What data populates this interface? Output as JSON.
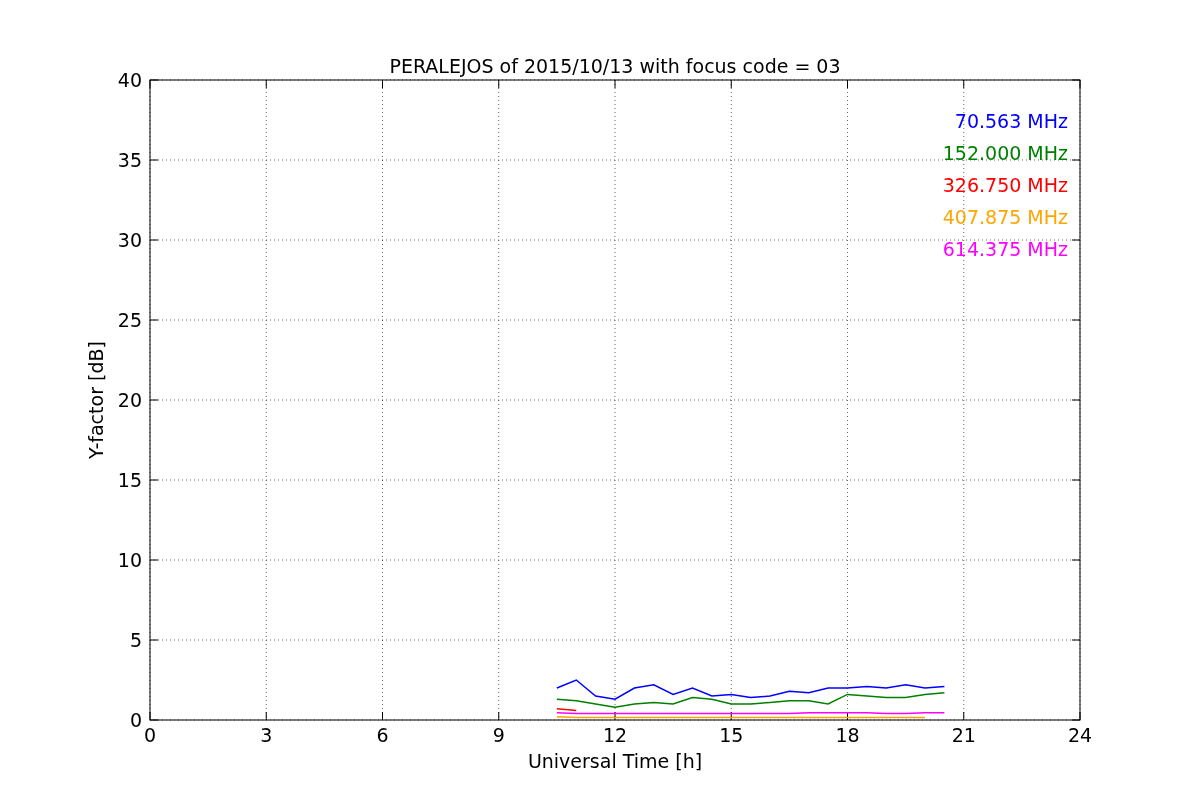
{
  "chart_data": {
    "type": "line",
    "title": "PERALEJOS of 2015/10/13 with focus code = 03",
    "xlabel": "Universal Time [h]",
    "ylabel": "Y-factor [dB]",
    "x": [
      10.5,
      11,
      11.5,
      12,
      12.5,
      13,
      13.5,
      14,
      14.5,
      15,
      15.5,
      16,
      16.5,
      17,
      17.5,
      18,
      18.5,
      19,
      19.5,
      20,
      20.5
    ],
    "series": [
      {
        "name": "70.563 MHz",
        "color": "#0000ff",
        "values": [
          2.0,
          2.5,
          1.5,
          1.3,
          2.0,
          2.2,
          1.6,
          2.0,
          1.5,
          1.6,
          1.4,
          1.5,
          1.8,
          1.7,
          2.0,
          2.0,
          2.1,
          2.0,
          2.2,
          2.0,
          2.1
        ]
      },
      {
        "name": "152.000 MHz",
        "color": "#008000",
        "values": [
          1.3,
          1.2,
          1.0,
          0.8,
          1.0,
          1.1,
          1.0,
          1.4,
          1.3,
          1.0,
          1.0,
          1.1,
          1.2,
          1.2,
          1.0,
          1.6,
          1.5,
          1.4,
          1.4,
          1.6,
          1.7
        ]
      },
      {
        "name": "326.750 MHz",
        "color": "#ff0000",
        "values": [
          0.7,
          0.6,
          null,
          null,
          null,
          null,
          null,
          null,
          null,
          null,
          null,
          null,
          null,
          null,
          null,
          null,
          null,
          null,
          null,
          null,
          null
        ]
      },
      {
        "name": "407.875 MHz",
        "color": "#ffa500",
        "values": [
          0.2,
          0.15,
          0.15,
          0.15,
          0.15,
          0.15,
          0.15,
          0.15,
          0.15,
          0.15,
          0.15,
          0.15,
          0.15,
          0.15,
          0.15,
          0.15,
          0.15,
          0.15,
          0.15,
          0.15,
          null
        ]
      },
      {
        "name": "614.375 MHz",
        "color": "#ff00ff",
        "values": [
          0.45,
          0.4,
          0.4,
          0.4,
          0.4,
          0.4,
          0.4,
          0.4,
          0.4,
          0.4,
          0.4,
          0.4,
          0.4,
          0.45,
          0.45,
          0.45,
          0.45,
          0.4,
          0.4,
          0.45,
          0.45
        ]
      }
    ],
    "grid": true,
    "xlim": [
      0,
      24
    ],
    "ylim": [
      0,
      40
    ],
    "xticks": [
      0,
      3,
      6,
      9,
      12,
      15,
      18,
      21,
      24
    ],
    "yticks": [
      0,
      5,
      10,
      15,
      20,
      25,
      30,
      35,
      40
    ]
  }
}
